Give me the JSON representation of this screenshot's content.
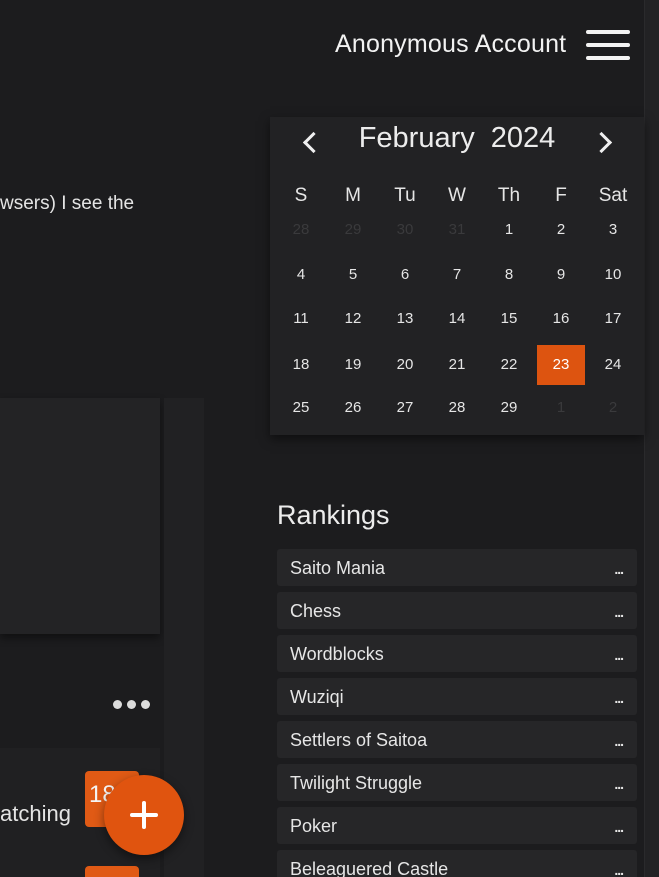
{
  "header": {
    "account_label": "Anonymous Account"
  },
  "post": {
    "text_fragment": "wsers) I see the",
    "watching_fragment": "atching",
    "badge_count": "18"
  },
  "calendar": {
    "month": "February",
    "year": "2024",
    "weekdays": [
      "S",
      "M",
      "Tu",
      "W",
      "Th",
      "F",
      "Sat"
    ],
    "weeks": [
      [
        "28",
        "29",
        "30",
        "31",
        "1",
        "2",
        "3"
      ],
      [
        "4",
        "5",
        "6",
        "7",
        "8",
        "9",
        "10"
      ],
      [
        "11",
        "12",
        "13",
        "14",
        "15",
        "16",
        "17"
      ],
      [
        "18",
        "19",
        "20",
        "21",
        "22",
        "23",
        "24"
      ],
      [
        "25",
        "26",
        "27",
        "28",
        "29",
        "1",
        "2"
      ]
    ],
    "selected_day": "23",
    "accent_color": "#dd5410"
  },
  "rankings": {
    "title": "Rankings",
    "more_label": "...",
    "items": [
      "Saito Mania",
      "Chess",
      "Wordblocks",
      "Wuziqi",
      "Settlers of Saitoa",
      "Twilight Struggle",
      "Poker",
      "Beleaguered Castle"
    ]
  },
  "icons": {
    "menu": "hamburger-icon",
    "prev": "chevron-left-icon",
    "next": "chevron-right-icon",
    "more": "ellipsis-icon",
    "fab": "plus-icon"
  }
}
